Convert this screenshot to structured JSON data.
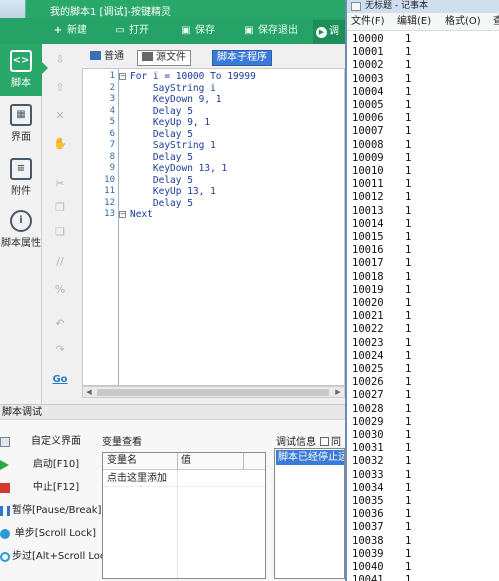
{
  "app": {
    "title": "我的脚本1 [调试]-按键精灵",
    "toolbar": [
      {
        "icon": "plus-icon",
        "label": "新建"
      },
      {
        "icon": "open-icon",
        "label": "打开"
      },
      {
        "icon": "save-icon",
        "label": "保存"
      },
      {
        "icon": "save-exit-icon",
        "label": "保存退出"
      }
    ],
    "debug_button": "调",
    "sidebar": [
      {
        "icon": "script-icon",
        "label": "脚本"
      },
      {
        "icon": "interface-icon",
        "label": "界面"
      },
      {
        "icon": "attachment-icon",
        "label": "附件"
      },
      {
        "icon": "info-icon",
        "label": "脚本属性"
      }
    ],
    "view_tabs": {
      "normal": "普通",
      "source": "源文件",
      "sub": "脚本子程序"
    },
    "line_numbers": [
      "1",
      "2",
      "3",
      "4",
      "5",
      "6",
      "7",
      "8",
      "9",
      "10",
      "11",
      "12",
      "13"
    ],
    "code": [
      "For i = 10000 To 19999",
      "    SayString i",
      "    KeyDown 9, 1",
      "    Delay 5",
      "    KeyUp 9, 1",
      "    Delay 5",
      "    SayString 1",
      "    Delay 5",
      "    KeyDown 13, 1",
      "    Delay 5",
      "    KeyUp 13, 1",
      "    Delay 5",
      "Next"
    ],
    "debug_panel": {
      "title": "脚本调试",
      "buttons": [
        {
          "icon": "custom-ui-icon",
          "label": "自定义界面"
        },
        {
          "icon": "play-icon",
          "label": "启动[F10]"
        },
        {
          "icon": "stop-icon",
          "label": "中止[F12]"
        },
        {
          "icon": "pause-icon",
          "label": "暂停[Pause/Break]"
        },
        {
          "icon": "step-icon",
          "label": "单步[Scroll Lock]"
        },
        {
          "icon": "step-over-icon",
          "label": "步过[Alt+Scroll Lock]"
        }
      ],
      "vars_label": "变量查看",
      "vars_col_name": "变量名",
      "vars_col_value": "值",
      "vars_add": "点击这里添加",
      "info_label": "调试信息",
      "info_checkbox": "同",
      "info_line": "脚本已经停止运"
    }
  },
  "notepad": {
    "title": "无标题 - 记事本",
    "menu": [
      "文件(F)",
      "编辑(E)",
      "格式(O)",
      "查"
    ],
    "rows": [
      [
        "10000",
        "1"
      ],
      [
        "10001",
        "1"
      ],
      [
        "10002",
        "1"
      ],
      [
        "10003",
        "1"
      ],
      [
        "10004",
        "1"
      ],
      [
        "10005",
        "1"
      ],
      [
        "10006",
        "1"
      ],
      [
        "10007",
        "1"
      ],
      [
        "10008",
        "1"
      ],
      [
        "10009",
        "1"
      ],
      [
        "10010",
        "1"
      ],
      [
        "10011",
        "1"
      ],
      [
        "10012",
        "1"
      ],
      [
        "10013",
        "1"
      ],
      [
        "10014",
        "1"
      ],
      [
        "10015",
        "1"
      ],
      [
        "10016",
        "1"
      ],
      [
        "10017",
        "1"
      ],
      [
        "10018",
        "1"
      ],
      [
        "10019",
        "1"
      ],
      [
        "10020",
        "1"
      ],
      [
        "10021",
        "1"
      ],
      [
        "10022",
        "1"
      ],
      [
        "10023",
        "1"
      ],
      [
        "10024",
        "1"
      ],
      [
        "10025",
        "1"
      ],
      [
        "10026",
        "1"
      ],
      [
        "10027",
        "1"
      ],
      [
        "10028",
        "1"
      ],
      [
        "10029",
        "1"
      ],
      [
        "10030",
        "1"
      ],
      [
        "10031",
        "1"
      ],
      [
        "10032",
        "1"
      ],
      [
        "10033",
        "1"
      ],
      [
        "10034",
        "1"
      ],
      [
        "10035",
        "1"
      ],
      [
        "10036",
        "1"
      ],
      [
        "10037",
        "1"
      ],
      [
        "10038",
        "1"
      ],
      [
        "10039",
        "1"
      ],
      [
        "10040",
        "1"
      ],
      [
        "10041",
        "1"
      ]
    ]
  },
  "colors": {
    "accent": "#2aa86a",
    "selection": "#3b7bd8"
  }
}
